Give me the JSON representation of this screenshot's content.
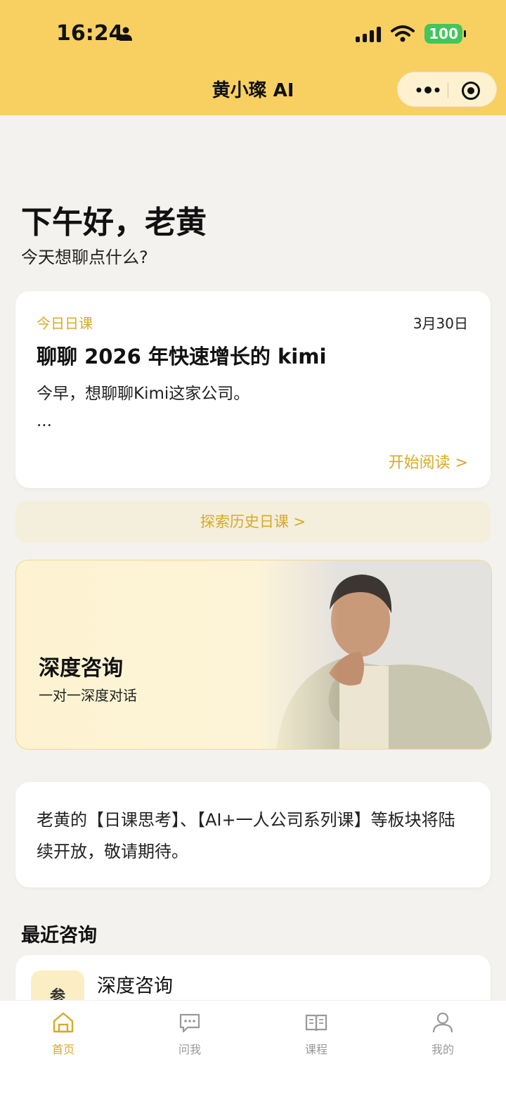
{
  "status": {
    "time": "16:24",
    "battery": "100"
  },
  "header": {
    "title": "黄小璨 AI"
  },
  "greeting": {
    "title": "下午好，老黄",
    "subtitle": "今天想聊点什么?"
  },
  "daily": {
    "label": "今日日课",
    "date": "3月30日",
    "title": "聊聊 2026 年快速增长的 kimi",
    "excerpt": "今早，想聊聊Kimi这家公司。",
    "ellipsis": "...",
    "read": "开始阅读 >"
  },
  "history": {
    "label": "探索历史日课 >"
  },
  "consult": {
    "title": "深度咨询",
    "subtitle": "一对一深度对话"
  },
  "notice": {
    "text": "老黄的【日课思考】、【AI+一人公司系列课】等板块将陆续开放，敬请期待。"
  },
  "recent": {
    "title": "最近咨询",
    "items": [
      {
        "icon_text": "参",
        "title": "深度咨询"
      }
    ]
  },
  "tabs": [
    {
      "label": "首页",
      "icon": "home-icon"
    },
    {
      "label": "问我",
      "icon": "chat-bubble-icon"
    },
    {
      "label": "课程",
      "icon": "book-icon"
    },
    {
      "label": "我的",
      "icon": "user-icon"
    }
  ],
  "colors": {
    "accent": "#d8a928",
    "header_bg": "#f8d061",
    "battery": "#43c55a"
  }
}
